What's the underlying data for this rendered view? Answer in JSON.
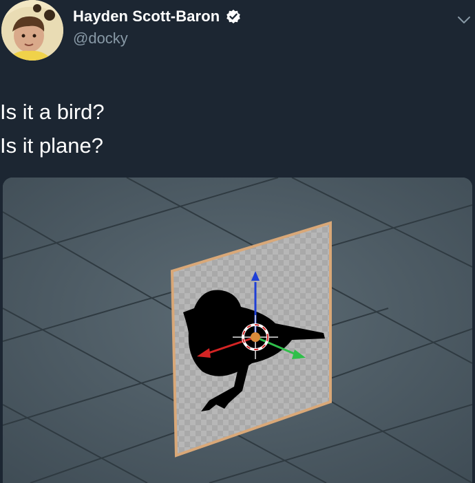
{
  "tweet": {
    "author": {
      "display_name": "Hayden Scott-Baron",
      "handle": "@docky",
      "verified": true
    },
    "text_lines": [
      "Is it a bird?",
      "Is it plane?"
    ],
    "icons": {
      "verified": "verified-badge-icon",
      "menu": "chevron-down-icon"
    },
    "media": {
      "description_type": "3d-viewport-screenshot"
    }
  },
  "colors": {
    "background": "#1c2632",
    "secondary_text": "#8899a6",
    "plane_outline": "#d9a878",
    "axis_x": "#d42424",
    "axis_y": "#2fbf4a",
    "axis_z": "#1e3fd6"
  }
}
